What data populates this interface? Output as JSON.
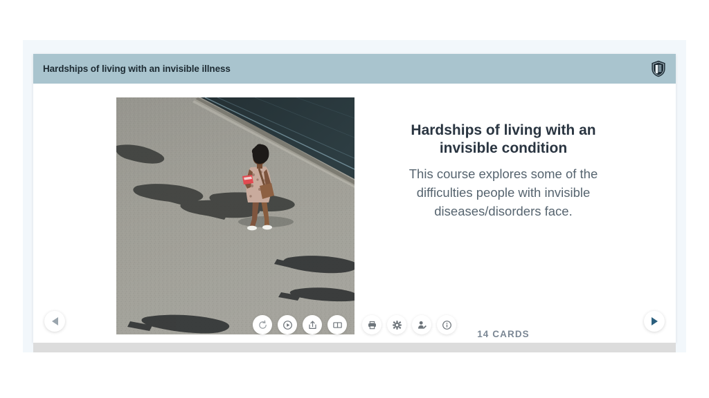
{
  "window": {
    "background_color": "#ffffff",
    "panel_color": "#f2f7fb"
  },
  "header": {
    "title": "Hardships of living with an invisible illness",
    "background_color": "#a9c4ce",
    "text_color": "#1d2b33",
    "logo_icon": "shield-logo-icon"
  },
  "cover": {
    "alt": "Aerial photo of a woman walking on grey pavement casting long shadows",
    "icon": "cover-photo"
  },
  "course": {
    "title": "Hardships of living with an invisible condition",
    "description": "This course explores some of the difficulties people with invisible diseases/disorders face.",
    "card_count_label": "14 CARDS",
    "title_color": "#2a3541",
    "description_color": "#56646f",
    "count_color": "#7b8794"
  },
  "navigation": {
    "prev_label": "Previous",
    "prev_icon": "triangle-left-icon",
    "prev_color": "#9aa5ad",
    "next_label": "Next",
    "next_icon": "triangle-right-icon",
    "next_color": "#2b5f7e"
  },
  "toolbar": {
    "icon_color": "#6d747a",
    "items": [
      {
        "name": "restart-button",
        "icon": "restart-circular-arrow-icon",
        "label": "Restart"
      },
      {
        "name": "play-button",
        "icon": "play-circle-icon",
        "label": "Play"
      },
      {
        "name": "share-button",
        "icon": "share-export-icon",
        "label": "Share"
      },
      {
        "name": "flashcards-button",
        "icon": "open-book-icon",
        "label": "Flashcards"
      },
      {
        "name": "print-button",
        "icon": "printer-icon",
        "label": "Print"
      },
      {
        "name": "settings-button",
        "icon": "gear-icon",
        "label": "Settings"
      },
      {
        "name": "profile-button",
        "icon": "user-edit-icon",
        "label": "Profile"
      },
      {
        "name": "info-button",
        "icon": "info-circle-icon",
        "label": "Info"
      }
    ]
  },
  "bottom_bar": {
    "color": "#dcdcdc"
  }
}
